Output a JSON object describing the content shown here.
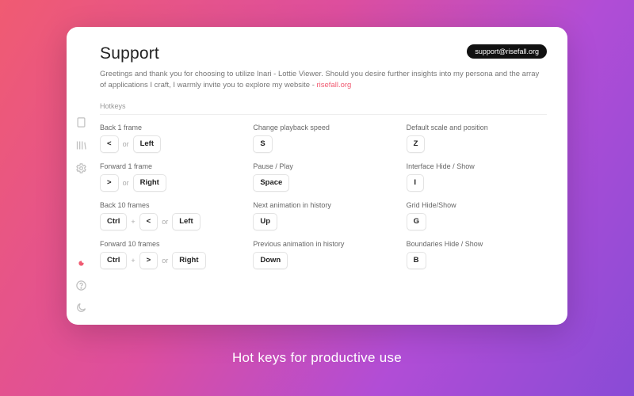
{
  "header": {
    "title": "Support",
    "email": "support@risefall.org",
    "lead_pre": "Greetings and thank you for choosing to utilize Inari - Lottie Viewer. Should you desire further insights into my persona and the array of applications I craft, I warmly invite you to explore my website - ",
    "lead_link": "risefall.org"
  },
  "section_label": "Hotkeys",
  "hotkeys": {
    "r0c0": {
      "label": "Back 1 frame",
      "keys": [
        "<",
        "Left"
      ],
      "joins": [
        "or"
      ]
    },
    "r0c1": {
      "label": "Change playback speed",
      "keys": [
        "S"
      ],
      "joins": []
    },
    "r0c2": {
      "label": "Default scale and position",
      "keys": [
        "Z"
      ],
      "joins": []
    },
    "r1c0": {
      "label": "Forward 1 frame",
      "keys": [
        ">",
        "Right"
      ],
      "joins": [
        "or"
      ]
    },
    "r1c1": {
      "label": "Pause / Play",
      "keys": [
        "Space"
      ],
      "joins": []
    },
    "r1c2": {
      "label": "Interface Hide / Show",
      "keys": [
        "I"
      ],
      "joins": []
    },
    "r2c0": {
      "label": "Back 10 frames",
      "keys": [
        "Ctrl",
        "<",
        "Left"
      ],
      "joins": [
        "+",
        "or"
      ]
    },
    "r2c1": {
      "label": "Next animation in history",
      "keys": [
        "Up"
      ],
      "joins": []
    },
    "r2c2": {
      "label": "Grid Hide/Show",
      "keys": [
        "G"
      ],
      "joins": []
    },
    "r3c0": {
      "label": "Forward 10 frames",
      "keys": [
        "Ctrl",
        ">",
        "Right"
      ],
      "joins": [
        "+",
        "or"
      ]
    },
    "r3c1": {
      "label": "Previous animation in history",
      "keys": [
        "Down"
      ],
      "joins": []
    },
    "r3c2": {
      "label": "Boundaries Hide / Show",
      "keys": [
        "B"
      ],
      "joins": []
    }
  },
  "tagline": "Hot keys for productive use"
}
